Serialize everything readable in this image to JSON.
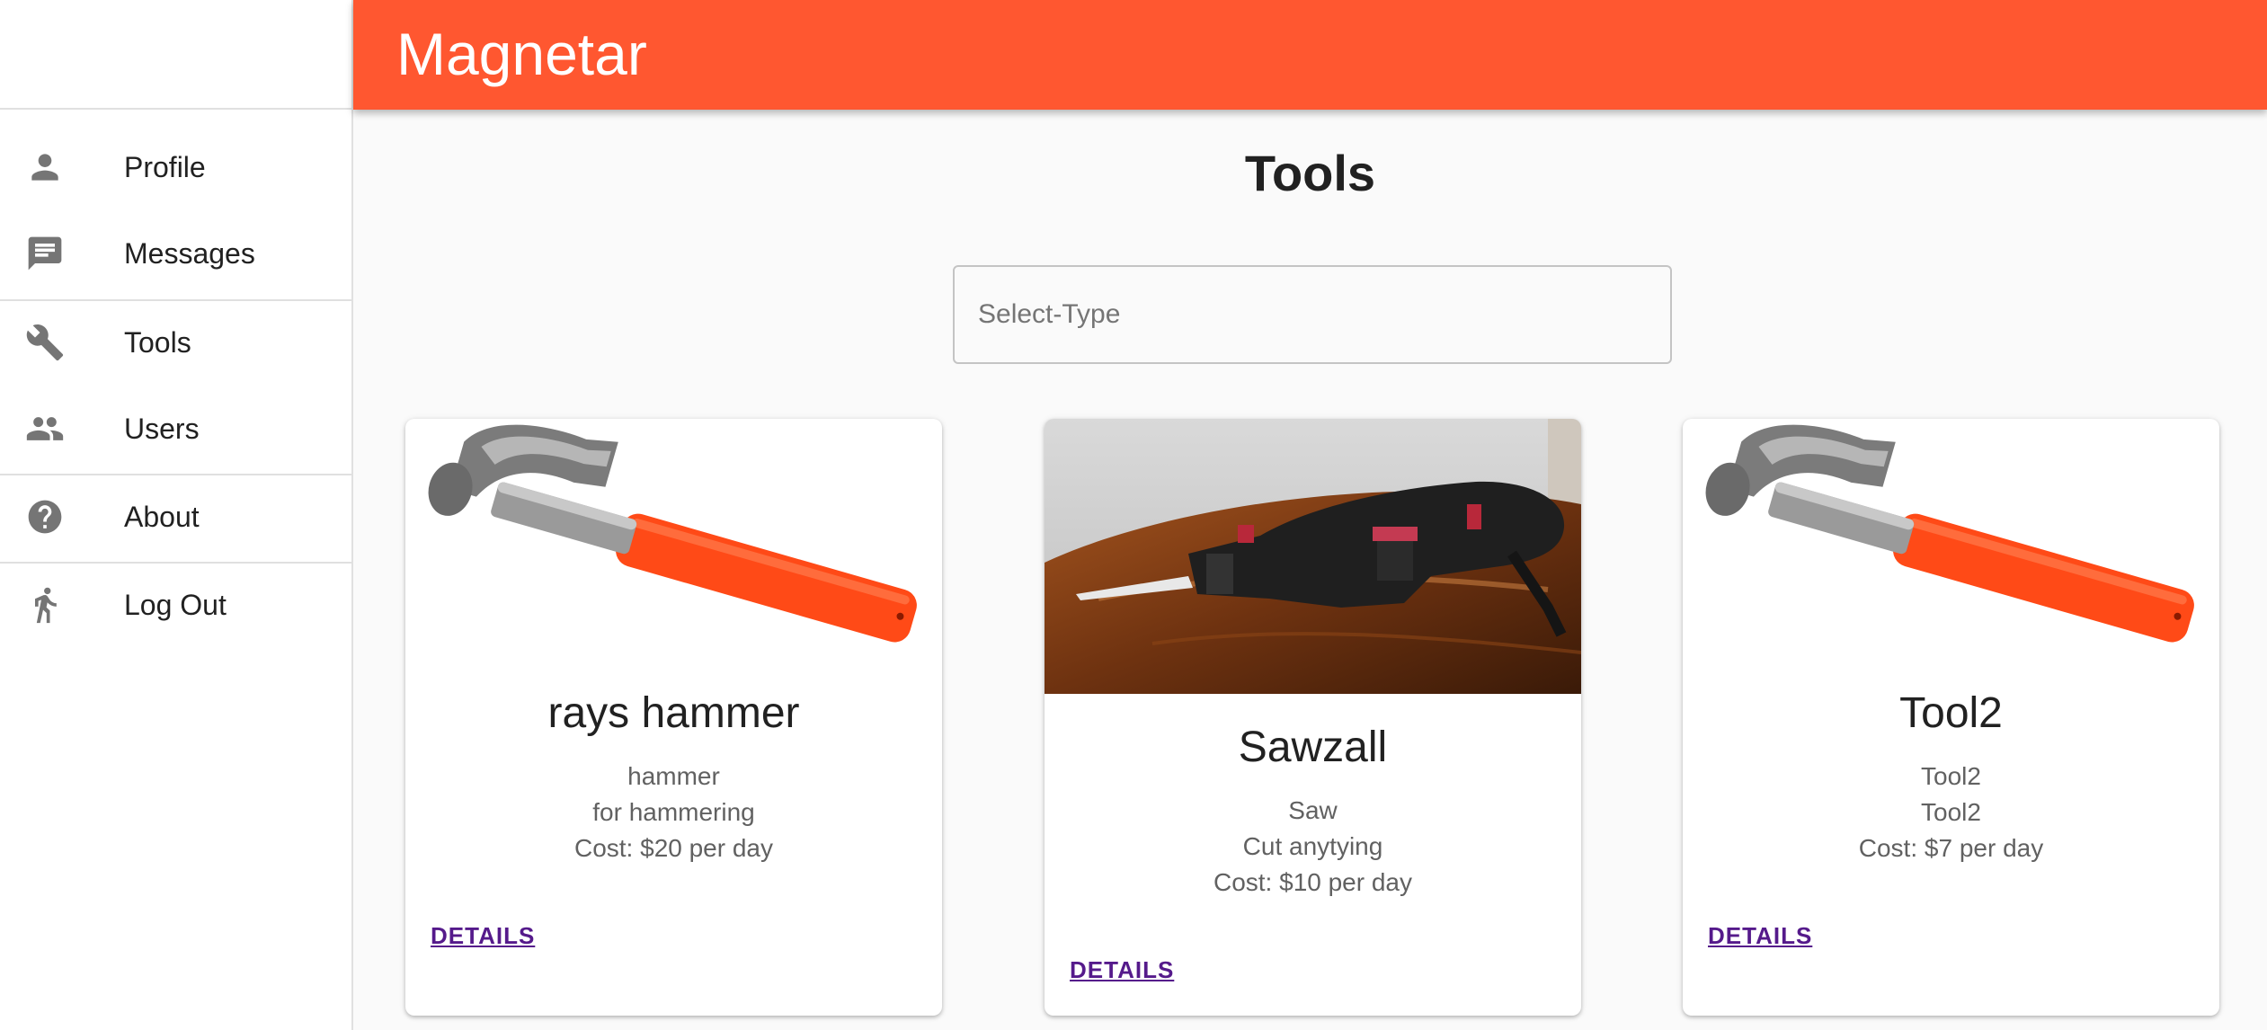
{
  "app": {
    "title": "Magnetar"
  },
  "sidebar": {
    "items": [
      {
        "label": "Profile",
        "icon": "person-icon"
      },
      {
        "label": "Messages",
        "icon": "message-icon"
      },
      {
        "label": "Tools",
        "icon": "wrench-icon"
      },
      {
        "label": "Users",
        "icon": "people-icon"
      },
      {
        "label": "About",
        "icon": "help-icon"
      },
      {
        "label": "Log Out",
        "icon": "walk-icon"
      }
    ]
  },
  "main": {
    "title": "Tools",
    "select_placeholder": "Select-Type",
    "cards": [
      {
        "name": "rays hammer",
        "type": "hammer",
        "description": "for hammering",
        "cost": "Cost: $20 per day",
        "action": "DETAILS",
        "image": "hammer"
      },
      {
        "name": "Sawzall",
        "type": "Saw",
        "description": "Cut anytying",
        "cost": "Cost: $10 per day",
        "action": "DETAILS",
        "image": "reciprocating-saw"
      },
      {
        "name": "Tool2",
        "type": "Tool2",
        "description": "Tool2",
        "cost": "Cost: $7 per day",
        "action": "DETAILS",
        "image": "hammer"
      }
    ]
  },
  "colors": {
    "app_bar": "#ff5730",
    "link": "#551a8b",
    "hammer_handle": "#ff4a17"
  }
}
